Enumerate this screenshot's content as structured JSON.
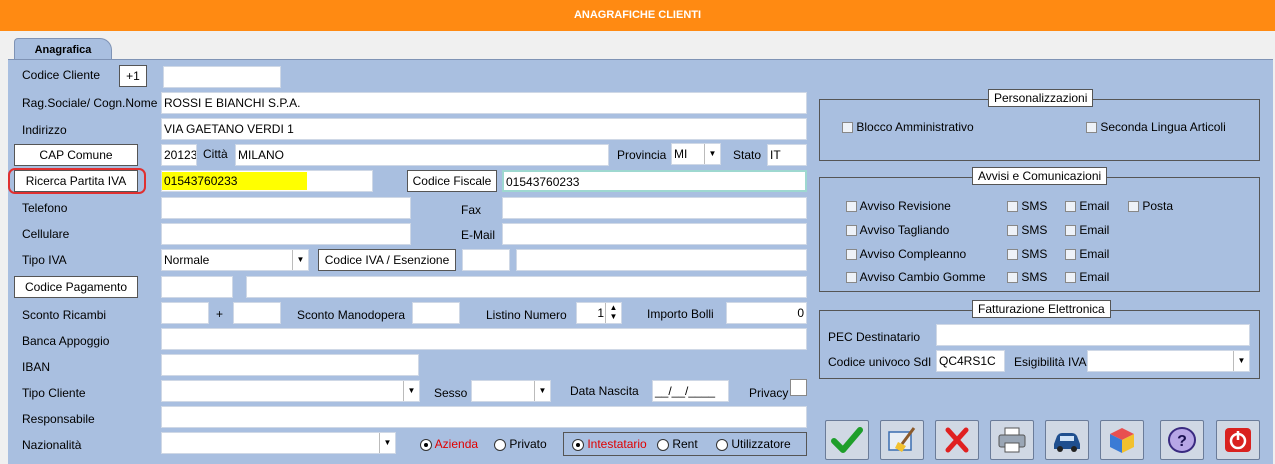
{
  "window": {
    "title": "ANAGRAFICHE CLIENTI"
  },
  "tabs": [
    {
      "label": "Anagrafica"
    }
  ],
  "form": {
    "codice_cliente": {
      "label": "Codice Cliente",
      "plus_btn": "+1",
      "value": ""
    },
    "rag_sociale": {
      "label": "Rag.Sociale/ Cogn.Nome",
      "value": "ROSSI E BIANCHI S.P.A."
    },
    "indirizzo": {
      "label": "Indirizzo",
      "value": "VIA GAETANO VERDI 1"
    },
    "cap_comune": {
      "btn": "CAP Comune",
      "cap": "20123",
      "citta_label": "Città",
      "citta": "MILANO",
      "provincia_label": "Provincia",
      "provincia": "MI",
      "stato_label": "Stato",
      "stato": "IT"
    },
    "partita_iva": {
      "btn": "Ricerca Partita IVA",
      "value": "01543760233",
      "cf_btn": "Codice Fiscale",
      "cf_value": "01543760233"
    },
    "telefono": {
      "label": "Telefono",
      "value": "",
      "fax_label": "Fax",
      "fax": ""
    },
    "cellulare": {
      "label": "Cellulare",
      "value": "",
      "email_label": "E-Mail",
      "email": ""
    },
    "tipo_iva": {
      "label": "Tipo IVA",
      "value": "Normale",
      "btn": "Codice IVA / Esenzione"
    },
    "codice_pagamento": {
      "btn": "Codice Pagamento"
    },
    "sconto": {
      "ricambi_label": "Sconto Ricambi",
      "plus": "+",
      "manodopera_label": "Sconto Manodopera",
      "listino_label": "Listino Numero",
      "listino_value": "1",
      "bolli_label": "Importo Bolli",
      "bolli_value": "0"
    },
    "banca": {
      "label": "Banca Appoggio"
    },
    "iban": {
      "label": "IBAN"
    },
    "tipo_cliente": {
      "label": "Tipo Cliente",
      "sesso_label": "Sesso",
      "nascita_label": "Data Nascita",
      "nascita_value": "__/__/____",
      "privacy_label": "Privacy"
    },
    "responsabile": {
      "label": "Responsabile"
    },
    "nazionalita": {
      "label": "Nazionalità"
    },
    "tipo_soggetto": {
      "azienda": "Azienda",
      "privato": "Privato"
    },
    "ruolo": {
      "intestatario": "Intestatario",
      "rent": "Rent",
      "utilizzatore": "Utilizzatore"
    }
  },
  "personalizzazioni": {
    "title": "Personalizzazioni",
    "blocco": "Blocco Amministrativo",
    "seconda_lingua": "Seconda Lingua Articoli"
  },
  "avvisi": {
    "title": "Avvisi e Comunicazioni",
    "rows": [
      {
        "label": "Avviso Revisione",
        "sms": "SMS",
        "email": "Email",
        "posta": "Posta"
      },
      {
        "label": "Avviso Tagliando",
        "sms": "SMS",
        "email": "Email"
      },
      {
        "label": "Avviso Compleanno",
        "sms": "SMS",
        "email": "Email"
      },
      {
        "label": "Avviso Cambio Gomme",
        "sms": "SMS",
        "email": "Email"
      }
    ]
  },
  "fatturazione": {
    "title": "Fatturazione Elettronica",
    "pec_label": "PEC Destinatario",
    "pec_value": "",
    "sdi_label": "Codice univoco SdI",
    "sdi_value": "QC4RS1C",
    "esigibilita_label": "Esigibilità IVA",
    "esigibilita_value": ""
  },
  "toolbar": [
    "confirm-icon",
    "edit-clean-icon",
    "delete-icon",
    "print-icon",
    "car-icon",
    "cube-icon",
    "help-icon",
    "power-icon"
  ],
  "colors": {
    "title_bar": "#ff8a12",
    "panel": "#a9bfe0",
    "highlight": "#ffff00",
    "active_text": "#e00000",
    "annotation": "#e03030"
  }
}
